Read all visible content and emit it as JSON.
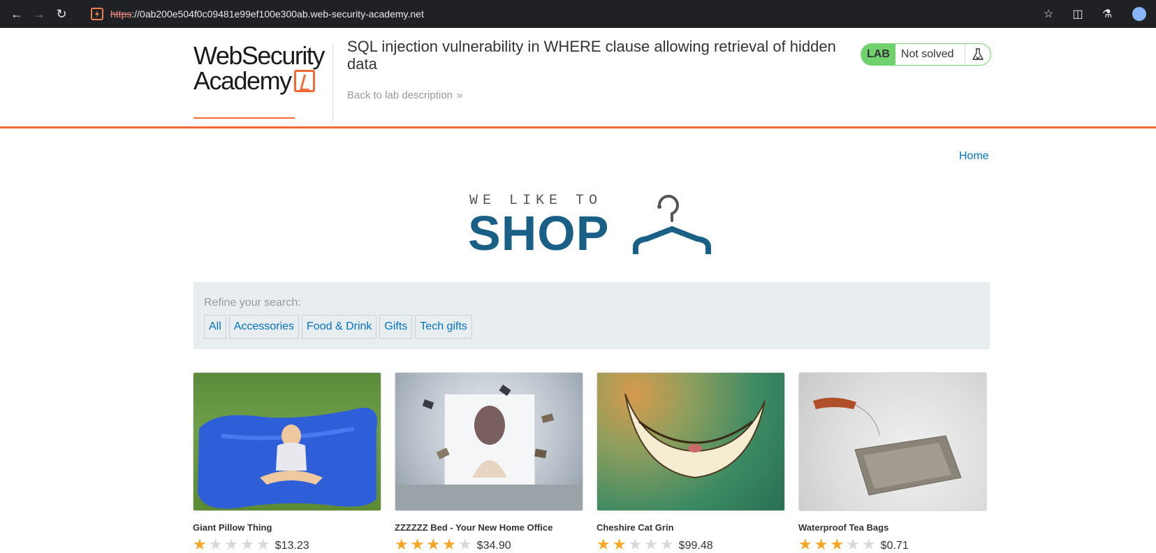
{
  "browser": {
    "url_scheme": "https",
    "url_rest": "://0ab200e504f0c09481e99ef100e300ab.web-security-academy.net"
  },
  "academy": {
    "logo_line1": "WebSecurity",
    "logo_line2": "Academy",
    "lab_title": "SQL injection vulnerability in WHERE clause allowing retrieval of hidden data",
    "back_link": "Back to lab description",
    "status_badge": "LAB",
    "status_text": "Not solved"
  },
  "shop": {
    "home_link": "Home",
    "tagline": "WE LIKE TO",
    "logo_word": "SHOP",
    "filter_label": "Refine your search:",
    "filters": [
      "All",
      "Accessories",
      "Food & Drink",
      "Gifts",
      "Tech gifts"
    ],
    "products": [
      {
        "name": "Giant Pillow Thing",
        "price": "$13.23",
        "rating": 1
      },
      {
        "name": "ZZZZZZ Bed - Your New Home Office",
        "price": "$34.90",
        "rating": 4
      },
      {
        "name": "Cheshire Cat Grin",
        "price": "$99.48",
        "rating": 2
      },
      {
        "name": "Waterproof Tea Bags",
        "price": "$0.71",
        "rating": 3
      }
    ]
  },
  "colors": {
    "accent": "#f26932",
    "link": "#0071bc",
    "shop_blue": "#1a5f85",
    "solved_green": "#70d16d",
    "star": "#f5a623"
  },
  "icons": [
    "back-arrow-icon",
    "forward-arrow-icon",
    "reload-icon",
    "site-icon",
    "star-bookmark-icon",
    "extensions-icon",
    "labs-icon",
    "flask-icon",
    "chevron-right-icon",
    "hanger-icon"
  ]
}
